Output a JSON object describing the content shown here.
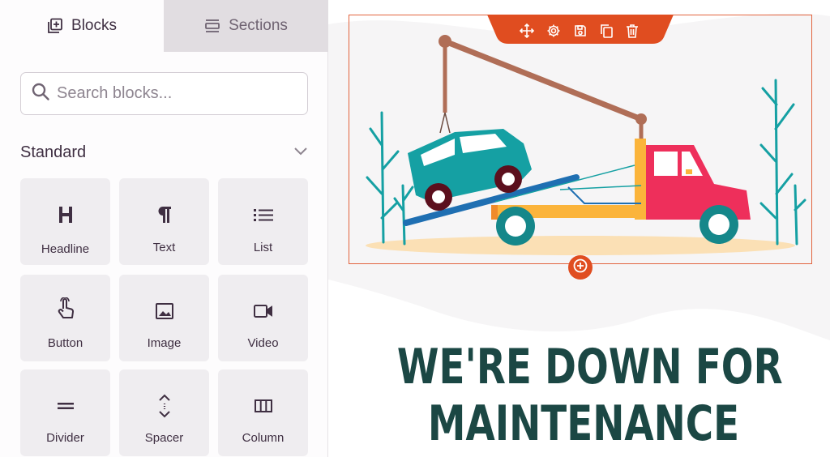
{
  "panel": {
    "tabs": [
      {
        "label": "Blocks",
        "icon": "blocks-add-icon",
        "active": true
      },
      {
        "label": "Sections",
        "icon": "sections-icon",
        "active": false
      }
    ],
    "search": {
      "placeholder": "Search blocks...",
      "value": "",
      "icon": "search-icon"
    },
    "section": {
      "title": "Standard",
      "icon": "chevron-down-icon"
    },
    "blocks": [
      {
        "label": "Headline",
        "icon": "headline-icon"
      },
      {
        "label": "Text",
        "icon": "paragraph-icon"
      },
      {
        "label": "List",
        "icon": "list-icon"
      },
      {
        "label": "Button",
        "icon": "pointer-hand-icon"
      },
      {
        "label": "Image",
        "icon": "image-icon"
      },
      {
        "label": "Video",
        "icon": "video-icon"
      },
      {
        "label": "Divider",
        "icon": "divider-icon"
      },
      {
        "label": "Spacer",
        "icon": "spacer-icon"
      },
      {
        "label": "Column",
        "icon": "column-icon"
      }
    ],
    "collapse_icon": "chevron-left-icon"
  },
  "canvas": {
    "toolbar": [
      "move-icon",
      "settings-icon",
      "save-icon",
      "duplicate-icon",
      "delete-icon"
    ],
    "add_icon": "plus-circle-icon",
    "headline": {
      "line1": "WE'RE DOWN FOR",
      "line2": "MAINTENANCE"
    },
    "colors": {
      "accent": "#e04d20",
      "headline": "#1b4744",
      "tab_inactive_bg": "#e1dde1",
      "block_bg": "#efedf0",
      "truck_red": "#ee2f5b",
      "truck_yellow": "#fbb43b",
      "car_teal": "#15a0a3"
    }
  }
}
